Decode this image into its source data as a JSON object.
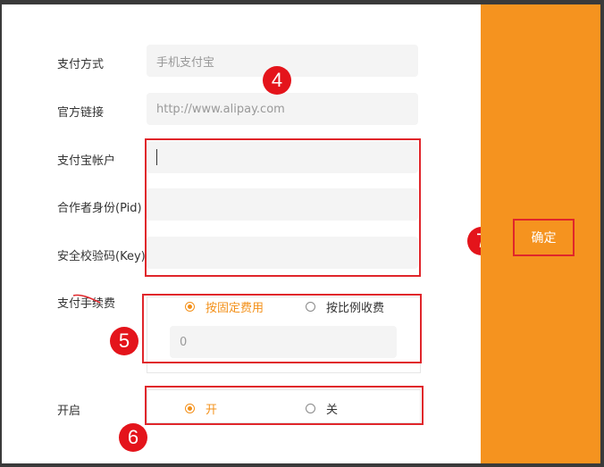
{
  "form": {
    "payment_method": {
      "label": "支付方式",
      "value": "手机支付宝"
    },
    "official_link": {
      "label": "官方链接",
      "value": "http://www.alipay.com"
    },
    "alipay_account": {
      "label": "支付宝帐户",
      "value": ""
    },
    "partner_id": {
      "label": "合作者身份(Pid)",
      "value": ""
    },
    "security_key": {
      "label": "安全校验码(Key)",
      "value": ""
    },
    "fee": {
      "label": "支付手续费",
      "options": [
        {
          "label": "按固定费用",
          "checked": true
        },
        {
          "label": "按比例收费",
          "checked": false
        }
      ],
      "value": "0"
    },
    "enable": {
      "label": "开启",
      "options": [
        {
          "label": "开",
          "checked": true
        },
        {
          "label": "关",
          "checked": false
        }
      ]
    }
  },
  "annotations": {
    "n4": "4",
    "n5": "5",
    "n6": "6",
    "n7": "7"
  },
  "sidebar": {
    "confirm_label": "确定"
  },
  "colors": {
    "accent": "#f5931f",
    "annotation_red": "#e0262b",
    "checked": "#f39019"
  }
}
